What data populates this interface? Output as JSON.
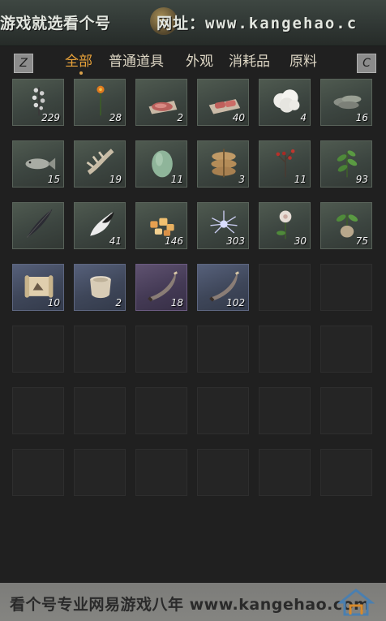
{
  "banner": {
    "left_text": "游戏就选看个号",
    "url_label": "网址：",
    "url_site": "www.kangehao.c"
  },
  "tabs": {
    "left_key": "Z",
    "right_key": "C",
    "items": [
      {
        "label": "全部",
        "active": true
      },
      {
        "label": "普通道具",
        "active": false
      },
      {
        "label": "外观",
        "active": false
      },
      {
        "label": "消耗品",
        "active": false
      },
      {
        "label": "原料",
        "active": false
      }
    ]
  },
  "inventory": {
    "items": [
      {
        "icon": "herb-sprig-icon",
        "qty": "229",
        "rarity": "green"
      },
      {
        "icon": "orange-flower-icon",
        "qty": "28",
        "rarity": "green"
      },
      {
        "icon": "raw-meat-icon",
        "qty": "2",
        "rarity": "green"
      },
      {
        "icon": "meat-slices-icon",
        "qty": "40",
        "rarity": "green"
      },
      {
        "icon": "cotton-ball-icon",
        "qty": "4",
        "rarity": "green"
      },
      {
        "icon": "fish-pile-icon",
        "qty": "16",
        "rarity": "green"
      },
      {
        "icon": "fish-icon",
        "qty": "15",
        "rarity": "green"
      },
      {
        "icon": "bone-icon",
        "qty": "19",
        "rarity": "green"
      },
      {
        "icon": "melon-icon",
        "qty": "11",
        "rarity": "green"
      },
      {
        "icon": "grain-sack-icon",
        "qty": "3",
        "rarity": "green"
      },
      {
        "icon": "red-berry-branch-icon",
        "qty": "11",
        "rarity": "green"
      },
      {
        "icon": "leafy-plant-icon",
        "qty": "93",
        "rarity": "green"
      },
      {
        "icon": "black-feather-icon",
        "qty": "",
        "rarity": "green"
      },
      {
        "icon": "fur-tuft-icon",
        "qty": "41",
        "rarity": "green"
      },
      {
        "icon": "ore-chunks-icon",
        "qty": "146",
        "rarity": "green"
      },
      {
        "icon": "crystal-shard-icon",
        "qty": "303",
        "rarity": "green"
      },
      {
        "icon": "white-flower-icon",
        "qty": "30",
        "rarity": "green"
      },
      {
        "icon": "root-plant-icon",
        "qty": "75",
        "rarity": "green"
      },
      {
        "icon": "scroll-icon",
        "qty": "10",
        "rarity": "blue"
      },
      {
        "icon": "jar-icon",
        "qty": "2",
        "rarity": "blue"
      },
      {
        "icon": "horn-icon",
        "qty": "18",
        "rarity": "purple"
      },
      {
        "icon": "horn-icon",
        "qty": "102",
        "rarity": "blue"
      }
    ],
    "total_slots": 42
  },
  "footer": {
    "text": "看个号专业网易游戏八年 www.kangehao.com",
    "logo": "house-logo-icon"
  }
}
